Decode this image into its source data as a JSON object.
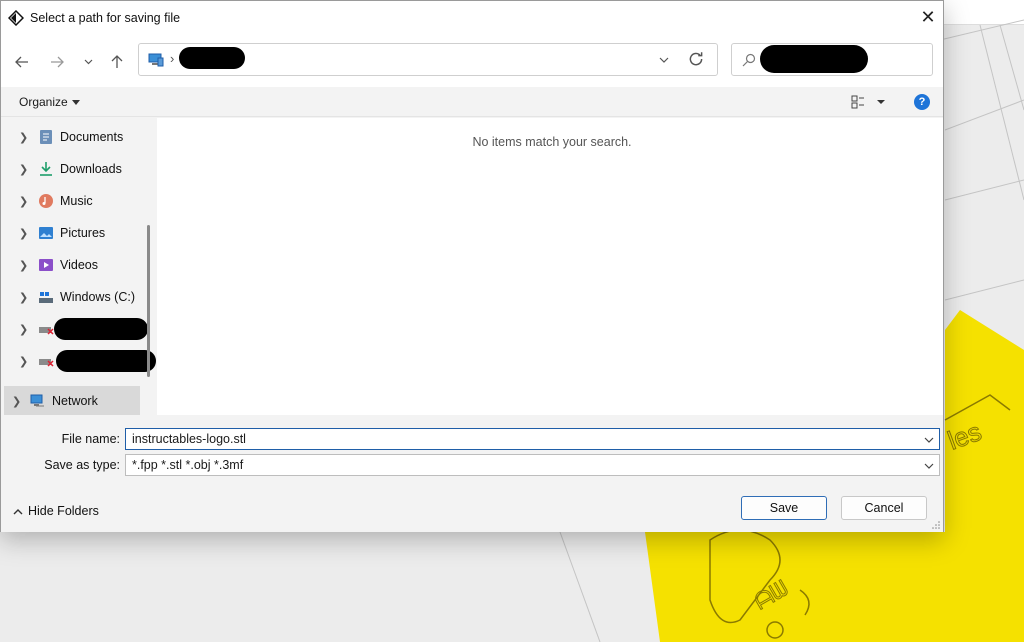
{
  "dialog": {
    "title": "Select a path for saving file",
    "close_label": "✕"
  },
  "navigation": {
    "back_icon": "arrow-left-icon",
    "forward_icon": "arrow-right-icon",
    "recent_icon": "chevron-down-icon",
    "up_icon": "arrow-up-icon",
    "address_separator": "›",
    "refresh_icon": "refresh-icon"
  },
  "commandbar": {
    "organize_label": "Organize",
    "help_label": "?"
  },
  "sidebar": {
    "items": [
      {
        "label": "Documents",
        "icon": "documents-icon"
      },
      {
        "label": "Downloads",
        "icon": "downloads-icon"
      },
      {
        "label": "Music",
        "icon": "music-icon"
      },
      {
        "label": "Pictures",
        "icon": "pictures-icon"
      },
      {
        "label": "Videos",
        "icon": "videos-icon"
      },
      {
        "label": "Windows (C:)",
        "icon": "drive-icon"
      },
      {
        "label": "",
        "icon": "network-drive-icon"
      },
      {
        "label": "",
        "icon": "network-drive-icon"
      },
      {
        "label": "Network",
        "icon": "network-icon"
      }
    ]
  },
  "main": {
    "empty_message": "No items match your search."
  },
  "form": {
    "filename_label": "File name:",
    "filename_value": "instructables-logo.stl",
    "filetype_label": "Save as type:",
    "filetype_value": "*.fpp *.stl *.obj *.3mf"
  },
  "footer": {
    "hide_folders_label": "Hide Folders",
    "save_label": "Save",
    "cancel_label": "Cancel"
  },
  "colors": {
    "accent": "#1e74d8",
    "background_model": "#f5e100"
  }
}
